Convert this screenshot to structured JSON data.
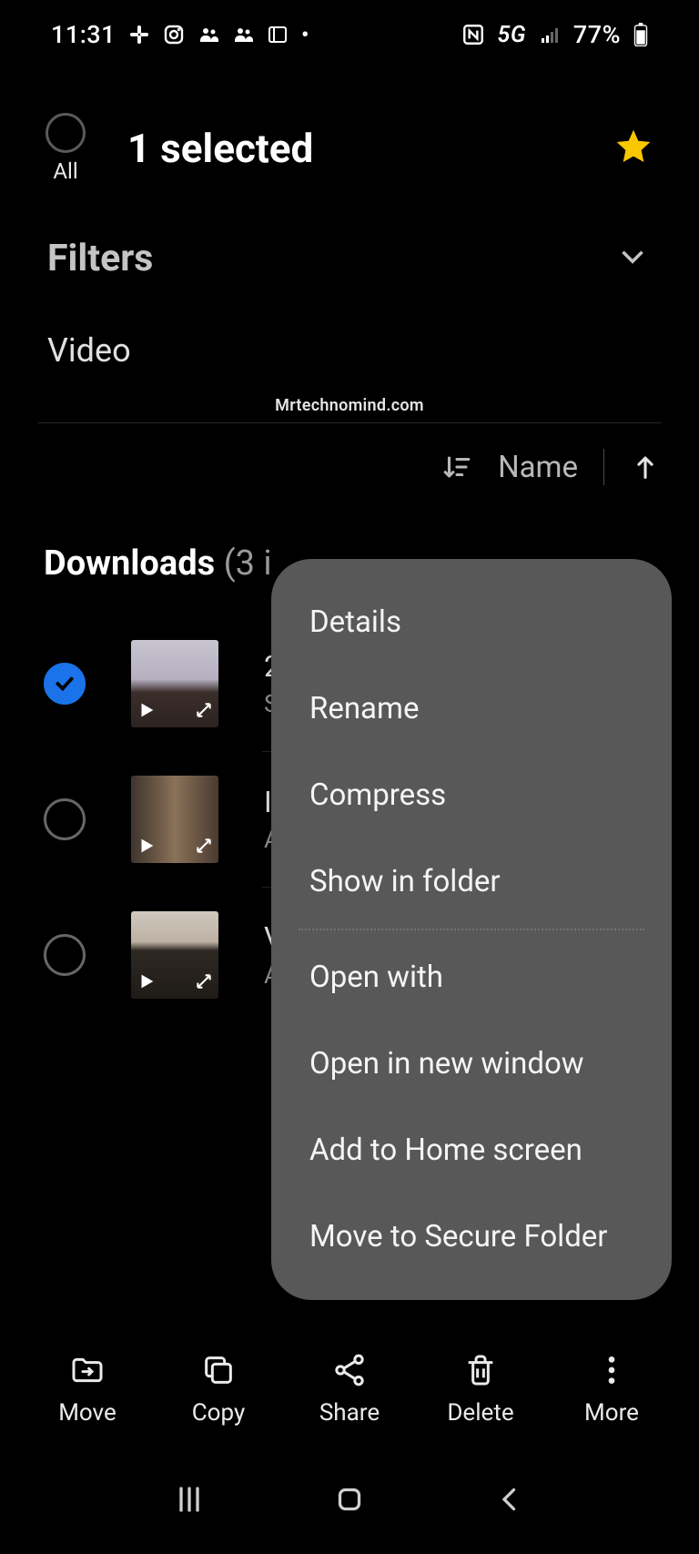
{
  "status_bar": {
    "time": "11:31",
    "battery": "77%",
    "network": "5G"
  },
  "header": {
    "all_label": "All",
    "title": "1 selected"
  },
  "filters": {
    "label": "Filters",
    "category": "Video"
  },
  "watermark": "Mrtechnomind.com",
  "sort": {
    "label": "Name"
  },
  "section": {
    "title": "Downloads",
    "count": "(3 i"
  },
  "files": [
    {
      "title": "2",
      "sub": "S",
      "checked": true
    },
    {
      "title": "I",
      "sub": "A",
      "checked": false
    },
    {
      "title": "V",
      "sub": "A",
      "checked": false
    }
  ],
  "context_menu": [
    "Details",
    "Rename",
    "Compress",
    "Show in folder",
    "Open with",
    "Open in new window",
    "Add to Home screen",
    "Move to Secure Folder"
  ],
  "bottom_nav": {
    "move": "Move",
    "copy": "Copy",
    "share": "Share",
    "delete": "Delete",
    "more": "More"
  }
}
